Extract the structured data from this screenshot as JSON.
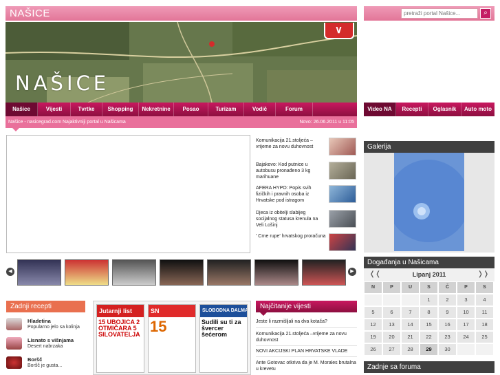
{
  "site": {
    "title": "NAŠICE",
    "banner_title": "NAŠICE",
    "search_placeholder": "pretraži portal Našice..."
  },
  "main_nav": [
    "Našice",
    "Vijesti",
    "Tvrtke",
    "Shopping",
    "Nekretnine",
    "Posao",
    "Turizam",
    "Vodič",
    "Forum"
  ],
  "side_nav": [
    "Video NA",
    "Recepti",
    "Oglasnik",
    "Auto moto"
  ],
  "breadcrumb": {
    "text": "Našice - nasicegrad.com Najaktivniji portal u Našicama",
    "date": "Novo: 26.06.2011  u  11:05"
  },
  "news": [
    {
      "text": "Komunikacija 21.stoljeća –vrijeme za novu duhovnost"
    },
    {
      "text": "Bajakovo: Kod putnice u autobusu pronađeno 3 kg marihuane"
    },
    {
      "text": "AFERA HYPO:  Popis svih fizičkih i pravnih osoba iz Hrvatske pod istragom"
    },
    {
      "text": "Djeca iz obitelji slabijeg socijalnog statusa krenula na Veli Lošinj"
    },
    {
      "text": "' Crne rupe' hrvatskog proračuna"
    }
  ],
  "strip": {
    "prev": "◀",
    "next": "▶"
  },
  "recipes": {
    "heading": "Zadnji recepti",
    "items": [
      {
        "title": "Hladetina",
        "subtitle": "Popularno jelo sa kolinja"
      },
      {
        "title": "Lisnato s višnjama",
        "subtitle": "Desert nabrzaka"
      },
      {
        "title": "Boršč",
        "subtitle": "Boršč je gusta..."
      }
    ]
  },
  "papers": [
    {
      "mast": "Jutarnji list",
      "head": "15 UBOJICA 2 OTMIČARA 5 SILOVATELJA"
    },
    {
      "mast": "SN",
      "head": "15"
    },
    {
      "mast": "SLOBODNA DALMACIJA",
      "head": "Sudili su ti za švercer šećerom"
    }
  ],
  "most_read": {
    "heading": "Najčitanije vijesti",
    "items": [
      "Jeste li razmišljali na dva kotača?",
      "Komunikacija 21.stoljeća –vrijeme za novu duhovnost",
      "NOVI AKCIJSKI PLAN HRVATSKE VLADE",
      "Ante Gotovac otkriva da je M. Morales brutalna u krevetu"
    ]
  },
  "gallery": {
    "heading": "Galerija"
  },
  "events": {
    "heading": "Događanja u Našicama",
    "month": "Lipanj 2011",
    "prev": "❬❬",
    "next": "❭❭",
    "weekdays": [
      "N",
      "P",
      "U",
      "S",
      "Č",
      "P",
      "S"
    ],
    "weeks": [
      [
        "",
        "",
        "",
        "1",
        "2",
        "3",
        "4"
      ],
      [
        "5",
        "6",
        "7",
        "8",
        "9",
        "10",
        "11"
      ],
      [
        "12",
        "13",
        "14",
        "15",
        "16",
        "17",
        "18"
      ],
      [
        "19",
        "20",
        "21",
        "22",
        "23",
        "24",
        "25"
      ],
      [
        "26",
        "27",
        "28",
        "29",
        "30",
        "",
        ""
      ]
    ],
    "today": "29"
  },
  "forum": {
    "heading": "Zadnje sa foruma"
  }
}
